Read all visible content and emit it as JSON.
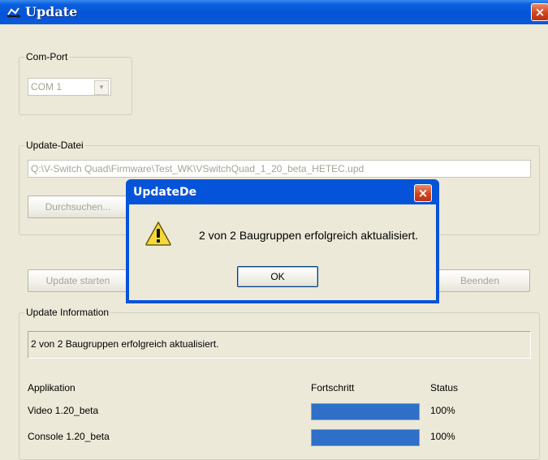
{
  "window": {
    "title": "Update",
    "close_glyph": "×"
  },
  "com_port": {
    "legend": "Com-Port",
    "selected": "COM 1"
  },
  "update_file": {
    "legend": "Update-Datei",
    "path": "Q:\\V-Switch Quad\\Firmware\\Test_WK\\VSwitchQuad_1_20_beta_HETEC.upd",
    "browse_label": "Durchsuchen..."
  },
  "actions": {
    "start_label": "Update starten",
    "exit_label": "Beenden"
  },
  "info": {
    "legend": "Update Information",
    "message": "2 von 2 Baugruppen erfolgreich aktualisiert.",
    "columns": {
      "app": "Applikation",
      "progress": "Fortschritt",
      "status": "Status"
    },
    "rows": [
      {
        "name": "Video  1.20_beta",
        "progress": 100,
        "status": "100%"
      },
      {
        "name": "Console  1.20_beta",
        "progress": 100,
        "status": "100%"
      }
    ]
  },
  "dialog": {
    "title": "UpdateDe",
    "message": "2 von 2 Baugruppen erfolgreich aktualisiert.",
    "ok_label": "OK",
    "icon": "warning-icon"
  },
  "colors": {
    "titlebar": "#0553d8",
    "window_bg": "#ece9d8",
    "progress_fill": "#2e6fc8",
    "close_red": "#d2431c"
  }
}
